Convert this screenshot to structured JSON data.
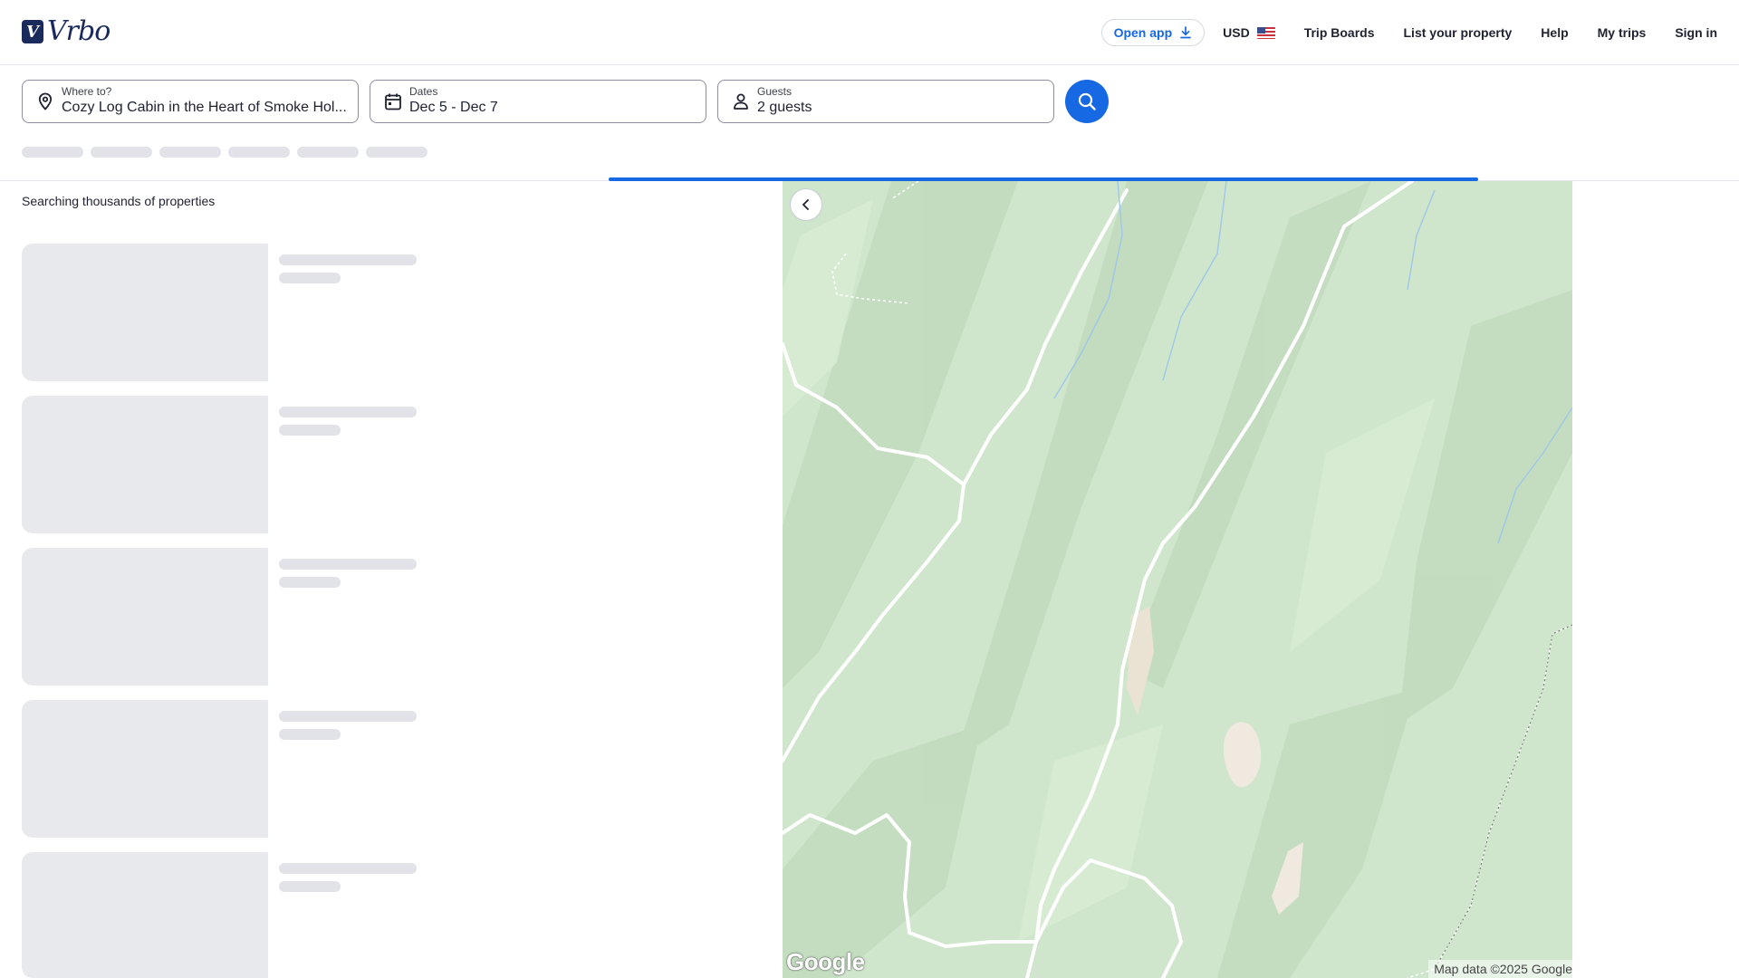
{
  "header": {
    "logo_text": "Vrbo",
    "logo_mark": "V",
    "open_app_label": "Open app",
    "currency_label": "USD",
    "nav_links": [
      "Trip Boards",
      "List your property",
      "Help",
      "My trips",
      "Sign in"
    ]
  },
  "search": {
    "destination": {
      "label": "Where to?",
      "value": "Cozy Log Cabin in the Heart of Smoke Hol..."
    },
    "dates": {
      "label": "Dates",
      "value": "Dec 5 - Dec 7"
    },
    "guests": {
      "label": "Guests",
      "value": "2 guests"
    }
  },
  "results": {
    "status_text": "Searching thousands of properties",
    "loading_progress": 1.0
  },
  "map": {
    "attribution": "Map data ©2025 Google",
    "provider_logo": "Google"
  },
  "colors": {
    "accent": "#1668e3",
    "brand": "#1b2a5c",
    "skeleton": "#e8e9ed",
    "map_land": "#cfe6cc"
  },
  "icons": {
    "destination": "location-pin-icon",
    "dates": "calendar-icon",
    "guests": "person-icon",
    "search": "search-icon",
    "open_app": "download-icon",
    "map_back": "chevron-left-icon"
  }
}
